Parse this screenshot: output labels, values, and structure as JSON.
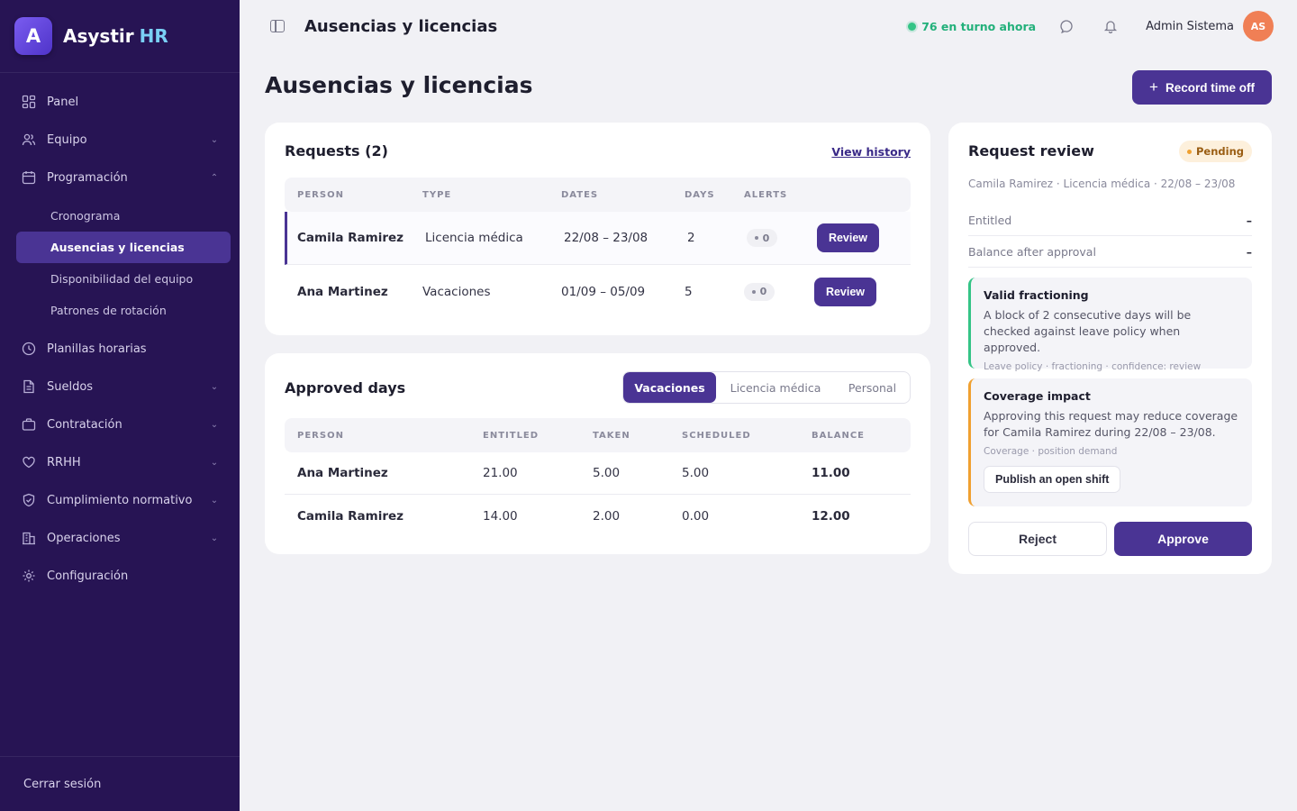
{
  "brand": {
    "name": "Asystir",
    "accent": "HR",
    "logo_letter": "A"
  },
  "sidebar": {
    "items": [
      {
        "label": "Panel",
        "icon": "dashboard-icon"
      },
      {
        "label": "Equipo",
        "icon": "users-icon",
        "expandable": true
      },
      {
        "label": "Programación",
        "icon": "calendar-icon",
        "expanded": true,
        "children": [
          {
            "label": "Cronograma"
          },
          {
            "label": "Ausencias y licencias",
            "active": true
          },
          {
            "label": "Disponibilidad del equipo"
          },
          {
            "label": "Patrones de rotación"
          }
        ]
      },
      {
        "label": "Planillas horarias",
        "icon": "clock-icon"
      },
      {
        "label": "Sueldos",
        "icon": "document-icon",
        "expandable": true
      },
      {
        "label": "Contratación",
        "icon": "briefcase-icon",
        "expandable": true
      },
      {
        "label": "RRHH",
        "icon": "heart-icon",
        "expandable": true
      },
      {
        "label": "Cumplimiento normativo",
        "icon": "shield-icon",
        "expandable": true
      },
      {
        "label": "Operaciones",
        "icon": "building-icon",
        "expandable": true
      },
      {
        "label": "Configuración",
        "icon": "gear-icon"
      }
    ],
    "logout": "Cerrar sesión"
  },
  "topbar": {
    "title": "Ausencias y licencias",
    "shift_status": "76 en turno ahora",
    "user_name": "Admin Sistema",
    "user_initials": "AS"
  },
  "page": {
    "title": "Ausencias y licencias",
    "record_button": "Record time off"
  },
  "requests": {
    "title": "Requests (2)",
    "history_link": "View history",
    "columns": [
      "PERSON",
      "TYPE",
      "DATES",
      "DAYS",
      "ALERTS"
    ],
    "rows": [
      {
        "person": "Camila Ramirez",
        "type": "Licencia médica",
        "dates": "22/08 – 23/08",
        "days": "2",
        "alerts": "0",
        "action": "Review"
      },
      {
        "person": "Ana Martinez",
        "type": "Vacaciones",
        "dates": "01/09 – 05/09",
        "days": "5",
        "alerts": "0",
        "action": "Review"
      }
    ]
  },
  "approved": {
    "title": "Approved days",
    "tabs": [
      "Vacaciones",
      "Licencia médica",
      "Personal"
    ],
    "columns": [
      "PERSON",
      "ENTITLED",
      "TAKEN",
      "SCHEDULED",
      "BALANCE"
    ],
    "rows": [
      {
        "person": "Ana Martinez",
        "entitled": "21.00",
        "taken": "5.00",
        "scheduled": "5.00",
        "balance": "11.00"
      },
      {
        "person": "Camila Ramirez",
        "entitled": "14.00",
        "taken": "2.00",
        "scheduled": "0.00",
        "balance": "12.00"
      }
    ]
  },
  "review": {
    "title": "Request review",
    "status": "Pending",
    "summary": "Camila Ramirez · Licencia médica · 22/08 – 23/08",
    "entitled_label": "Entitled",
    "entitled_value": "–",
    "balance_label": "Balance after approval",
    "balance_value": "–",
    "notes": [
      {
        "title": "Valid fractioning",
        "body": "A block of 2 consecutive days will be checked against leave policy when approved.",
        "meta": "Leave policy · fractioning · confidence: review"
      },
      {
        "title": "Coverage impact",
        "body": "Approving this request may reduce coverage for Camila Ramirez during 22/08 – 23/08.",
        "meta": "Coverage · position demand",
        "action": "Publish an open shift"
      }
    ],
    "reject": "Reject",
    "approve": "Approve"
  },
  "colors": {
    "sidebar": "#271454",
    "primary": "#4a3494",
    "success": "#34c486",
    "warning": "#f0a030"
  }
}
